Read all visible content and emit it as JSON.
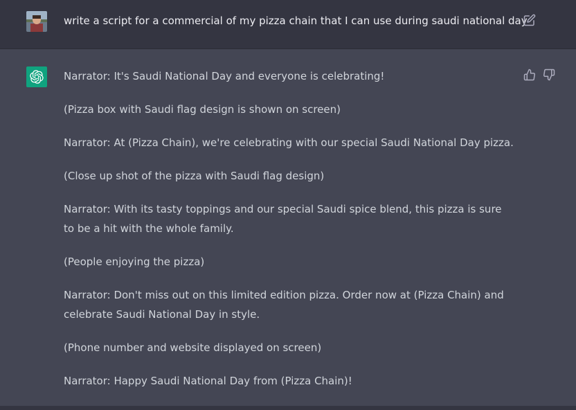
{
  "user_message": {
    "text": "write a script for a commercial of my pizza chain that I can use during saudi national day",
    "avatar_icon": "user-avatar-photo",
    "edit_icon": "edit-icon"
  },
  "assistant_message": {
    "avatar_icon": "openai-logo-icon",
    "paragraphs": [
      "Narrator: It's Saudi National Day and everyone is celebrating!",
      "(Pizza box with Saudi flag design is shown on screen)",
      "Narrator: At (Pizza Chain), we're celebrating with our special Saudi National Day pizza.",
      "(Close up shot of the pizza with Saudi flag design)",
      "Narrator: With its tasty toppings and our special Saudi spice blend, this pizza is sure to be a hit with the whole family.",
      "(People enjoying the pizza)",
      "Narrator: Don't miss out on this limited edition pizza. Order now at (Pizza Chain) and celebrate Saudi National Day in style.",
      "(Phone number and website displayed on screen)",
      "Narrator: Happy Saudi National Day from (Pizza Chain)!"
    ],
    "feedback": {
      "thumbs_up_icon": "thumbs-up-icon",
      "thumbs_down_icon": "thumbs-down-icon"
    }
  },
  "colors": {
    "user_row_bg": "#343541",
    "assistant_row_bg": "#444654",
    "brand_green": "#10a37f",
    "text_primary": "#ececf1",
    "text_response": "#d1d5db",
    "icon_gray": "#acacbe"
  }
}
